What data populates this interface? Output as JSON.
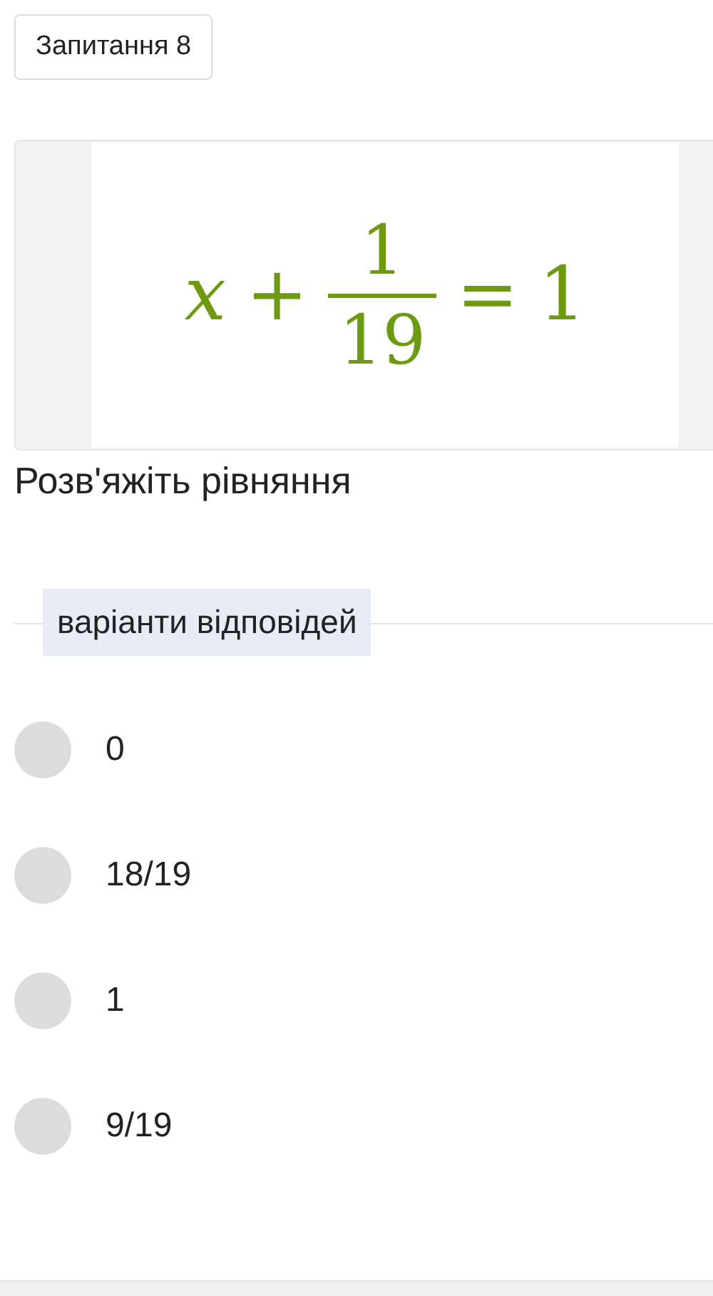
{
  "question_badge": "Запитання 8",
  "formula": {
    "variable": "x",
    "operator": "+",
    "numerator": "1",
    "denominator": "19",
    "equals": "=",
    "result": "1"
  },
  "prompt": "Розв'яжіть рівняння",
  "answers_legend": "варіанти відповідей",
  "options": [
    {
      "label": "0",
      "selected": false
    },
    {
      "label": "18/19",
      "selected": false
    },
    {
      "label": "1",
      "selected": false
    },
    {
      "label": "9/19",
      "selected": false
    }
  ]
}
